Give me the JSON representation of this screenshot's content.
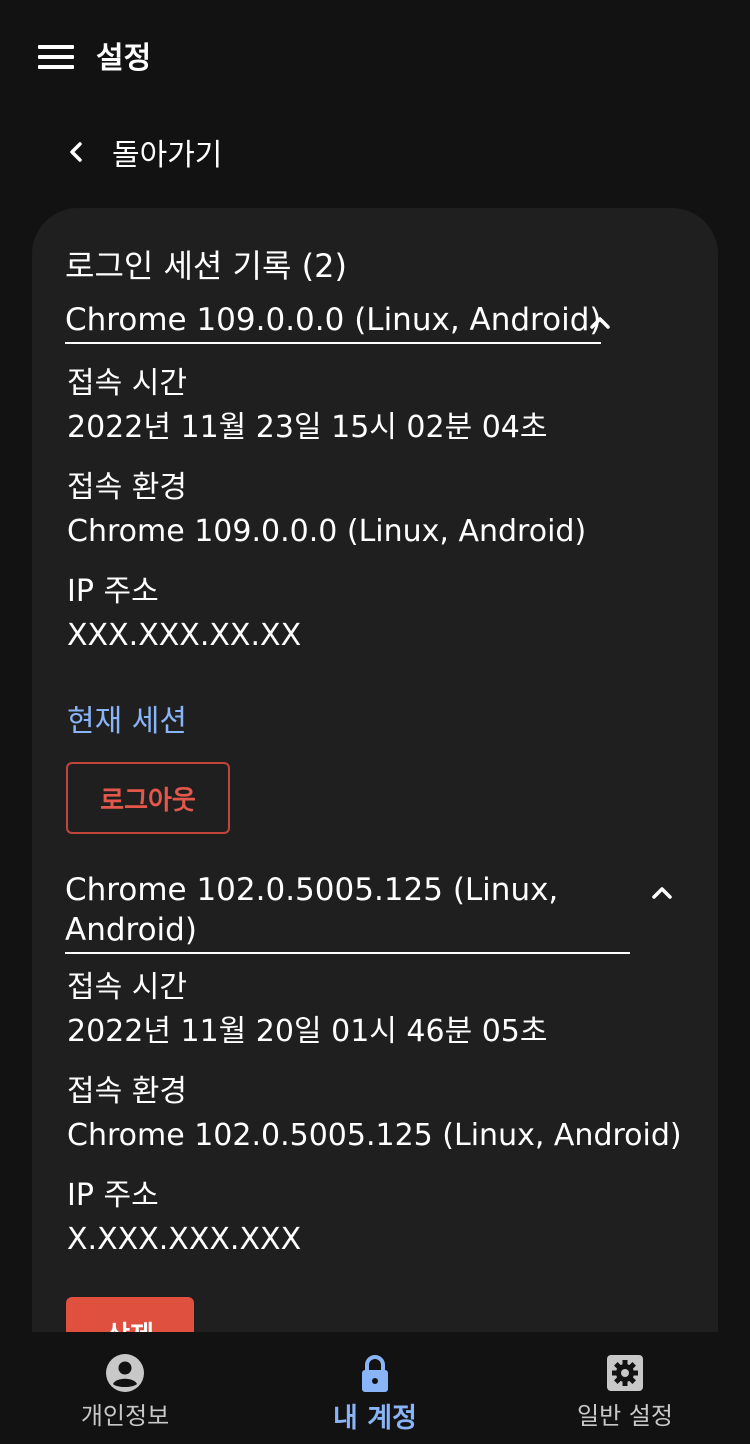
{
  "header": {
    "title": "설정"
  },
  "back": {
    "label": "돌아가기"
  },
  "card": {
    "title": "로그인 세션 기록 (2)"
  },
  "sessions": [
    {
      "name": "Chrome 109.0.0.0 (Linux, Android)",
      "time_label": "접속 시간",
      "time_value": "2022년 11월 23일 15시 02분 04초",
      "env_label": "접속 환경",
      "env_value": "Chrome 109.0.0.0 (Linux, Android)",
      "ip_label": "IP 주소",
      "ip_value": "XXX.XXX.XX.XX",
      "current_label": "현재 세션",
      "action_label": "로그아웃"
    },
    {
      "name": "Chrome 102.0.5005.125 (Linux, Android)",
      "time_label": "접속 시간",
      "time_value": "2022년 11월 20일 01시 46분 05초",
      "env_label": "접속 환경",
      "env_value": "Chrome 102.0.5005.125 (Linux, Android)",
      "ip_label": "IP 주소",
      "ip_value": "X.XXX.XXX.XXX",
      "action_label": "삭제"
    }
  ],
  "nav": [
    {
      "label": "개인정보",
      "icon": "account-circle-icon"
    },
    {
      "label": "내 계정",
      "icon": "lock-icon",
      "active": true
    },
    {
      "label": "일반 설정",
      "icon": "gear-icon"
    }
  ],
  "colors": {
    "background": "#121212",
    "card": "#1f1f20",
    "accent": "#8ab4f8",
    "danger": "#e0503f"
  }
}
